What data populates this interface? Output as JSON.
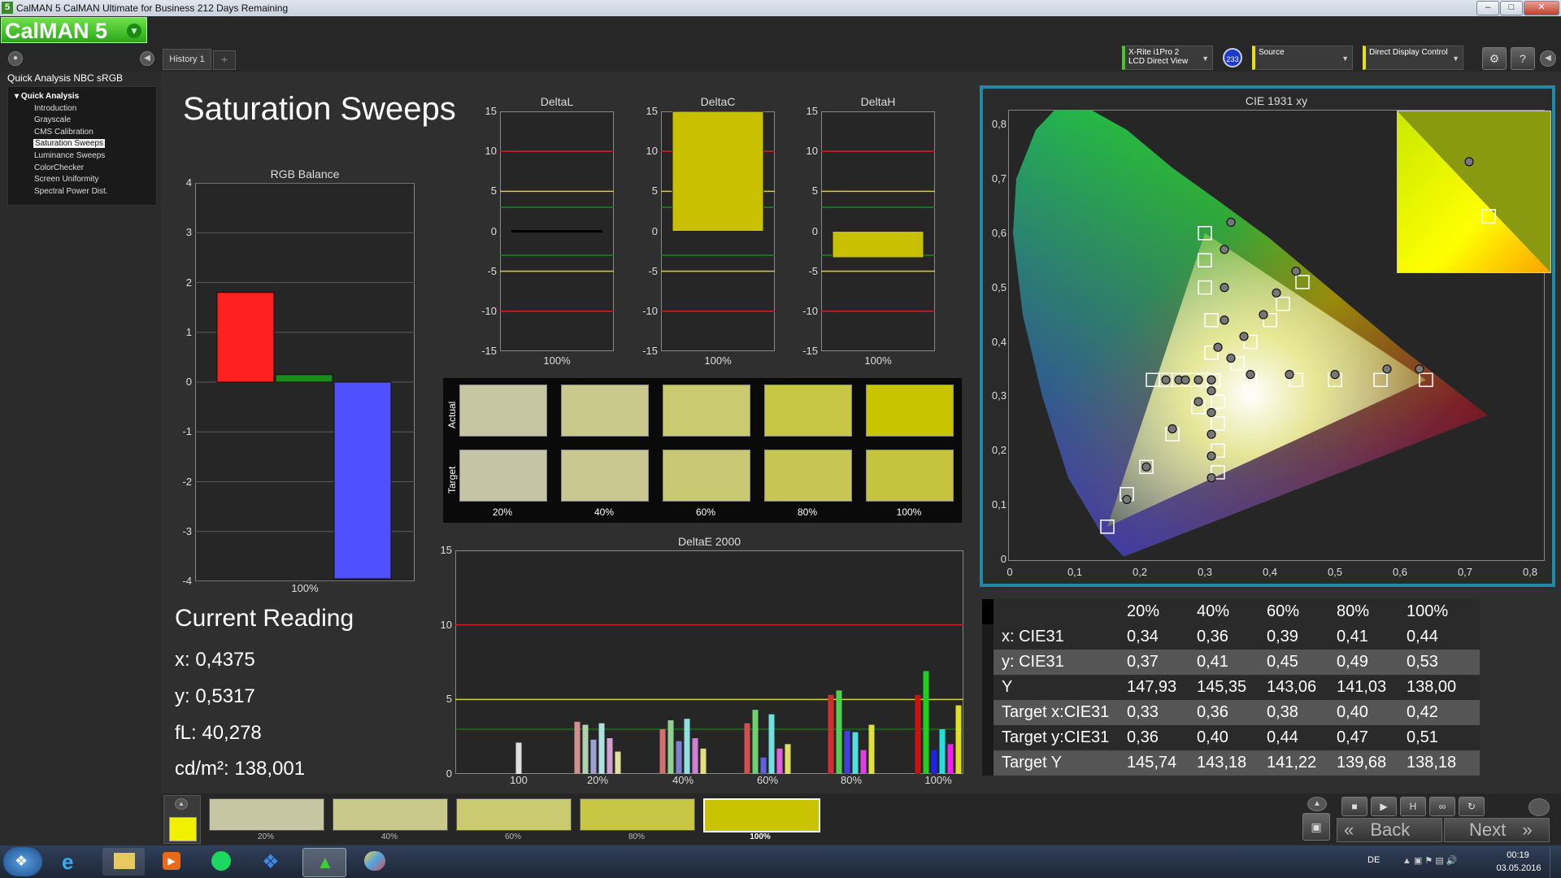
{
  "window": {
    "app_badge": "5",
    "title": "CalMAN 5 CalMAN Ultimate for Business 212 Days Remaining",
    "min": "–",
    "max": "□",
    "close": "✕"
  },
  "app": {
    "logo": "CalMAN 5",
    "history_tab": "History 1",
    "add_tab": "+",
    "meter": {
      "line1": "X-Rite i1Pro 2",
      "line2": "LCD Direct View"
    },
    "meter_badge": "233",
    "source": "Source",
    "display": "Direct Display Control",
    "settings_icon": "gear-icon",
    "help_icon": "?"
  },
  "nav": {
    "heading": "Quick Analysis NBC sRGB",
    "group": "Quick Analysis",
    "items": [
      "Introduction",
      "Grayscale",
      "CMS Calibration",
      "Saturation Sweeps",
      "Luminance Sweeps",
      "ColorChecker",
      "Screen Uniformity",
      "Spectral Power Dist."
    ],
    "selected": 3
  },
  "page": {
    "title": "Saturation Sweeps"
  },
  "rgb_balance": {
    "title": "RGB Balance",
    "yticks": [
      "4",
      "3",
      "2",
      "1",
      "0",
      "-1",
      "-2",
      "-3",
      "-4"
    ],
    "xlabel": "100%",
    "ylim": [
      -4,
      4
    ],
    "bars": [
      {
        "name": "Red",
        "value": 1.8,
        "color": "#ff2020"
      },
      {
        "name": "Green",
        "value": 0.15,
        "color": "#1a8a1a"
      },
      {
        "name": "Blue",
        "value": -3.95,
        "color": "#5050ff"
      }
    ]
  },
  "delta_charts": [
    {
      "title": "DeltaL",
      "value": 0.0,
      "color": "#000000",
      "xlabel": "100%"
    },
    {
      "title": "DeltaC",
      "value": 15.0,
      "color": "#c8c000",
      "xlabel": "100%"
    },
    {
      "title": "DeltaH",
      "value": -3.3,
      "color": "#c8c000",
      "xlabel": "100%"
    }
  ],
  "delta_yticks": [
    "15",
    "10",
    "5",
    "0",
    "-5",
    "-10",
    "-15"
  ],
  "swatches": {
    "row_actual": "Actual",
    "row_target": "Target",
    "labels": [
      "20%",
      "40%",
      "60%",
      "80%",
      "100%"
    ],
    "actual": [
      "#c6c6a2",
      "#c9c98c",
      "#caca70",
      "#c8c645",
      "#c8c400"
    ],
    "target": [
      "#c5c5a5",
      "#c8c890",
      "#c9c973",
      "#c7c553",
      "#c6c43e"
    ]
  },
  "deltae": {
    "title": "DeltaE 2000",
    "yticks": [
      "15",
      "10",
      "5",
      "0"
    ],
    "xlabels": [
      "100",
      "20%",
      "40%",
      "60%",
      "80%",
      "100%"
    ],
    "ylim": [
      0,
      15
    ],
    "groups": [
      {
        "label": "100",
        "bars": [
          {
            "v": 2.1,
            "c": "#e0e0e0"
          }
        ]
      },
      {
        "label": "20%",
        "bars": [
          {
            "v": 3.5,
            "c": "#d09090"
          },
          {
            "v": 3.3,
            "c": "#b0d0b0"
          },
          {
            "v": 2.3,
            "c": "#a0a0d0"
          },
          {
            "v": 3.4,
            "c": "#b0e0e0"
          },
          {
            "v": 2.4,
            "c": "#d0a0d0"
          },
          {
            "v": 1.5,
            "c": "#e0e0a0"
          }
        ]
      },
      {
        "label": "40%",
        "bars": [
          {
            "v": 3.0,
            "c": "#d07070"
          },
          {
            "v": 3.6,
            "c": "#90d090"
          },
          {
            "v": 2.2,
            "c": "#8080d0"
          },
          {
            "v": 3.7,
            "c": "#90e0e0"
          },
          {
            "v": 2.4,
            "c": "#d080d0"
          },
          {
            "v": 1.7,
            "c": "#e0e080"
          }
        ]
      },
      {
        "label": "60%",
        "bars": [
          {
            "v": 3.4,
            "c": "#d05050"
          },
          {
            "v": 4.3,
            "c": "#70d070"
          },
          {
            "v": 1.1,
            "c": "#6060e0"
          },
          {
            "v": 4.0,
            "c": "#70e0e0"
          },
          {
            "v": 1.7,
            "c": "#e060e0"
          },
          {
            "v": 2.0,
            "c": "#e0e060"
          }
        ]
      },
      {
        "label": "80%",
        "bars": [
          {
            "v": 5.3,
            "c": "#d03030"
          },
          {
            "v": 5.6,
            "c": "#50d050"
          },
          {
            "v": 2.9,
            "c": "#4040e0"
          },
          {
            "v": 2.8,
            "c": "#50e0e0"
          },
          {
            "v": 1.6,
            "c": "#e040e0"
          },
          {
            "v": 3.3,
            "c": "#e0e040"
          }
        ]
      },
      {
        "label": "100%",
        "bars": [
          {
            "v": 5.3,
            "c": "#d01010"
          },
          {
            "v": 6.9,
            "c": "#20d020"
          },
          {
            "v": 1.6,
            "c": "#2020f0"
          },
          {
            "v": 3.0,
            "c": "#20e0e0"
          },
          {
            "v": 2.0,
            "c": "#f020f0"
          },
          {
            "v": 4.6,
            "c": "#e0e020"
          }
        ]
      }
    ]
  },
  "reading": {
    "title": "Current Reading",
    "x": "x: 0,4375",
    "y": "y: 0,5317",
    "fl": "fL: 40,278",
    "cd": "cd/m²: 138,001"
  },
  "cie": {
    "title": "CIE 1931 xy",
    "xticks": [
      "0",
      "0,1",
      "0,2",
      "0,3",
      "0,4",
      "0,5",
      "0,6",
      "0,7",
      "0,8"
    ],
    "yticks": [
      "0,8",
      "0,7",
      "0,6",
      "0,5",
      "0,4",
      "0,3",
      "0,2",
      "0,1",
      "0"
    ],
    "gamut": [
      [
        0.64,
        0.33
      ],
      [
        0.3,
        0.6
      ],
      [
        0.15,
        0.06
      ]
    ],
    "targets": [
      [
        0.3,
        0.6
      ],
      [
        0.3,
        0.55
      ],
      [
        0.3,
        0.5
      ],
      [
        0.31,
        0.44
      ],
      [
        0.31,
        0.38
      ],
      [
        0.313,
        0.329
      ],
      [
        0.45,
        0.51
      ],
      [
        0.42,
        0.47
      ],
      [
        0.4,
        0.44
      ],
      [
        0.37,
        0.4
      ],
      [
        0.35,
        0.36
      ],
      [
        0.22,
        0.33
      ],
      [
        0.24,
        0.33
      ],
      [
        0.26,
        0.33
      ],
      [
        0.28,
        0.33
      ],
      [
        0.3,
        0.33
      ],
      [
        0.37,
        0.33
      ],
      [
        0.44,
        0.33
      ],
      [
        0.5,
        0.33
      ],
      [
        0.57,
        0.33
      ],
      [
        0.64,
        0.33
      ],
      [
        0.29,
        0.28
      ],
      [
        0.25,
        0.23
      ],
      [
        0.21,
        0.17
      ],
      [
        0.18,
        0.12
      ],
      [
        0.15,
        0.06
      ],
      [
        0.32,
        0.29
      ],
      [
        0.32,
        0.25
      ],
      [
        0.32,
        0.2
      ],
      [
        0.32,
        0.16
      ]
    ],
    "measured": [
      [
        0.34,
        0.62
      ],
      [
        0.33,
        0.57
      ],
      [
        0.33,
        0.5
      ],
      [
        0.33,
        0.44
      ],
      [
        0.32,
        0.39
      ],
      [
        0.31,
        0.33
      ],
      [
        0.44,
        0.53
      ],
      [
        0.41,
        0.49
      ],
      [
        0.39,
        0.45
      ],
      [
        0.36,
        0.41
      ],
      [
        0.34,
        0.37
      ],
      [
        0.24,
        0.33
      ],
      [
        0.26,
        0.33
      ],
      [
        0.27,
        0.33
      ],
      [
        0.29,
        0.33
      ],
      [
        0.31,
        0.33
      ],
      [
        0.37,
        0.34
      ],
      [
        0.43,
        0.34
      ],
      [
        0.5,
        0.34
      ],
      [
        0.58,
        0.35
      ],
      [
        0.63,
        0.35
      ],
      [
        0.29,
        0.29
      ],
      [
        0.25,
        0.24
      ],
      [
        0.21,
        0.17
      ],
      [
        0.18,
        0.11
      ],
      [
        0.31,
        0.31
      ],
      [
        0.31,
        0.27
      ],
      [
        0.31,
        0.23
      ],
      [
        0.31,
        0.19
      ],
      [
        0.31,
        0.15
      ]
    ],
    "inset_target": [
      0.4477,
      0.5015
    ],
    "inset_measured": [
      0.4375,
      0.5317
    ]
  },
  "table": {
    "headers": [
      "",
      "20%",
      "40%",
      "60%",
      "80%",
      "100%"
    ],
    "rows": [
      [
        "x: CIE31",
        "0,34",
        "0,36",
        "0,39",
        "0,41",
        "0,44"
      ],
      [
        "y: CIE31",
        "0,37",
        "0,41",
        "0,45",
        "0,49",
        "0,53"
      ],
      [
        "Y",
        "147,93",
        "145,35",
        "143,06",
        "141,03",
        "138,00"
      ],
      [
        "Target x:CIE31",
        "0,33",
        "0,36",
        "0,38",
        "0,40",
        "0,42"
      ],
      [
        "Target y:CIE31",
        "0,36",
        "0,40",
        "0,44",
        "0,47",
        "0,51"
      ],
      [
        "Target Y",
        "145,74",
        "143,18",
        "141,22",
        "139,68",
        "138,18"
      ]
    ]
  },
  "bottom": {
    "labels": [
      "20%",
      "40%",
      "60%",
      "80%",
      "100%"
    ],
    "colors": [
      "#c6c6a2",
      "#c9c98c",
      "#caca70",
      "#c8c645",
      "#c8c400"
    ],
    "current_color": "#f0f000",
    "back": "Back",
    "next": "Next"
  },
  "taskbar": {
    "lang": "DE",
    "time": "00:19",
    "date": "03.05.2016"
  }
}
